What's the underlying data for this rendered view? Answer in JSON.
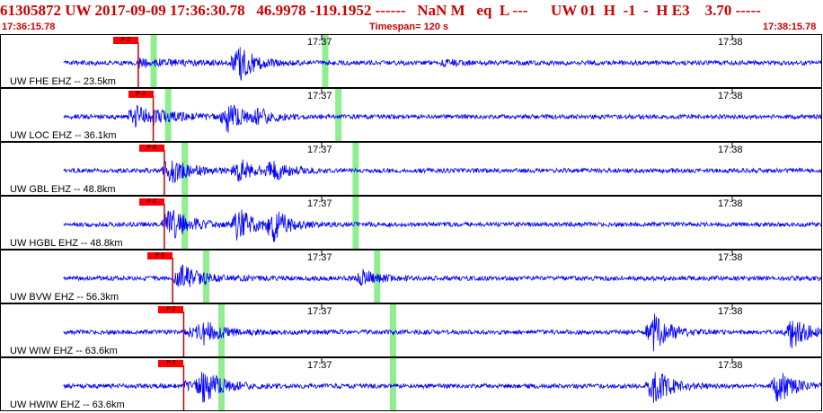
{
  "header": {
    "title": "61305872 UW 2017-09-09 17:36:30.78   46.9978 -119.1952 ------   NaN M   eq  L ---      UW 01  H  -1  -  H E3    3.70 -----",
    "start_time": "17:36:15.78",
    "timespan": "Timespan= 120 s",
    "end_time": "17:38:15.78"
  },
  "time_ticks": [
    "17:37",
    "17:38"
  ],
  "colors": {
    "trace": "#0000ff",
    "pick": "#ff0000",
    "pick_line": "#c00000",
    "window": "#90ee90",
    "header_text": "#cc0000"
  },
  "traces": [
    {
      "label": "UW FHE EHZ -- 23.5km",
      "pick": "P 2",
      "pick_time": 0.63,
      "windows": [
        2.8,
        27.6
      ],
      "start": -46,
      "events": [
        [
          -30,
          0.9
        ],
        [
          15,
          1.8
        ],
        [
          45,
          0.3
        ],
        [
          101,
          0.9
        ]
      ]
    },
    {
      "label": "UW LOC EHZ -- 36.1km",
      "pick": "P 2",
      "pick_time": 2.8,
      "windows": [
        4.9,
        29.5
      ],
      "start": -43,
      "events": [
        [
          0,
          1.2
        ],
        [
          13.5,
          1.4
        ],
        [
          18,
          0.6
        ],
        [
          102,
          1.3
        ]
      ]
    },
    {
      "label": "UW GBL EHZ -- 48.8km",
      "pick": "P 0",
      "pick_time": 4.4,
      "windows": [
        7.3,
        32.0
      ],
      "start": -41,
      "events": [
        [
          5,
          1.0
        ],
        [
          15,
          1.1
        ],
        [
          20,
          1.0
        ],
        [
          102,
          1.0
        ]
      ]
    },
    {
      "label": "UW HGBL EHZ -- 48.8km",
      "pick": "P 0",
      "pick_time": 4.4,
      "windows": [
        7.3,
        32.0
      ],
      "start": -40,
      "events": [
        [
          5,
          1.3
        ],
        [
          15,
          1.5
        ],
        [
          20,
          1.6
        ],
        [
          102,
          1.2
        ]
      ]
    },
    {
      "label": "UW BVW EHZ -- 56.3km",
      "pick": "P 0",
      "pick_time": 5.6,
      "windows": [
        10.4,
        35.1
      ],
      "start": -39,
      "events": [
        [
          7,
          0.9
        ],
        [
          33,
          0.8
        ],
        [
          104,
          0.9
        ]
      ]
    },
    {
      "label": "UW WIW EHZ -- 63.6km",
      "pick": "P 2",
      "pick_time": 7.2,
      "windows": [
        12.6,
        37.4
      ],
      "start": -38,
      "events": [
        [
          10,
          0.9
        ],
        [
          75,
          1.9
        ],
        [
          95,
          1.5
        ],
        [
          102,
          1.3
        ]
      ]
    },
    {
      "label": "UW HWIW EHZ -- 63.6km",
      "pick": "P 2",
      "pick_time": 7.2,
      "windows": [
        12.6,
        37.4
      ],
      "start": -38,
      "events": [
        [
          10,
          1.5
        ],
        [
          75,
          1.9
        ],
        [
          93,
          1.6
        ],
        [
          102,
          1.6
        ]
      ]
    }
  ]
}
